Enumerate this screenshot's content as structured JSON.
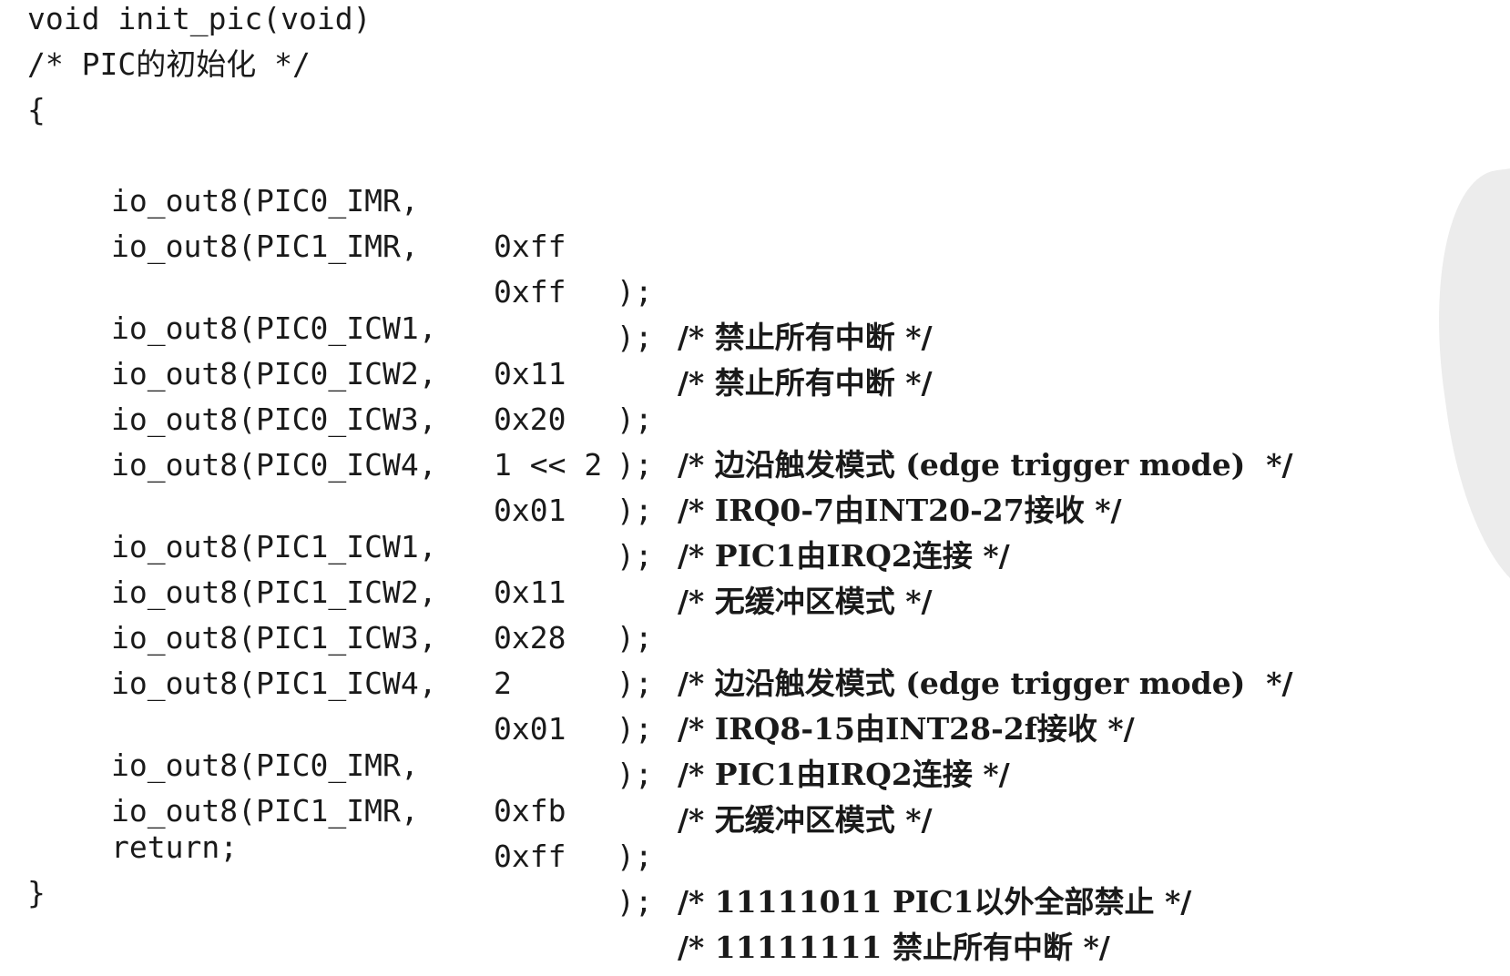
{
  "header": {
    "signature": "void init_pic(void)",
    "comment": "/* PIC的初始化 */",
    "open_brace": "{"
  },
  "statements": [
    {
      "call": "io_out8(PIC0_IMR,",
      "arg": "0xff",
      "close": ");",
      "comment": "/* 禁止所有中断 */"
    },
    {
      "call": "io_out8(PIC1_IMR,",
      "arg": "0xff",
      "close": ");",
      "comment": "/* 禁止所有中断 */"
    },
    {
      "call": "io_out8(PIC0_ICW1,",
      "arg": "0x11",
      "close": ");",
      "comment": "/* 边沿触发模式 (edge trigger mode)  */"
    },
    {
      "call": "io_out8(PIC0_ICW2,",
      "arg": "0x20",
      "close": ");",
      "comment": "/* IRQ0-7由INT20-27接收 */"
    },
    {
      "call": "io_out8(PIC0_ICW3,",
      "arg": "1 << 2",
      "close": ");",
      "comment": "/* PIC1由IRQ2连接 */"
    },
    {
      "call": "io_out8(PIC0_ICW4,",
      "arg": "0x01",
      "close": ");",
      "comment": "/* 无缓冲区模式 */"
    },
    {
      "call": "io_out8(PIC1_ICW1,",
      "arg": "0x11",
      "close": ");",
      "comment": "/* 边沿触发模式 (edge trigger mode)  */"
    },
    {
      "call": "io_out8(PIC1_ICW2,",
      "arg": "0x28",
      "close": ");",
      "comment": "/* IRQ8-15由INT28-2f接收 */"
    },
    {
      "call": "io_out8(PIC1_ICW3,",
      "arg": "2",
      "close": ");",
      "comment": "/* PIC1由IRQ2连接 */"
    },
    {
      "call": "io_out8(PIC1_ICW4,",
      "arg": "0x01",
      "close": ");",
      "comment": "/* 无缓冲区模式 */"
    },
    {
      "call": "io_out8(PIC0_IMR,",
      "arg": "0xfb",
      "close": ");",
      "comment": "/* 11111011 PIC1以外全部禁止 */"
    },
    {
      "call": "io_out8(PIC1_IMR,",
      "arg": "0xff",
      "close": ");",
      "comment": "/* 11111111 禁止所有中断 */"
    }
  ],
  "footer": {
    "return_stmt": "return;",
    "close_brace": "}"
  }
}
